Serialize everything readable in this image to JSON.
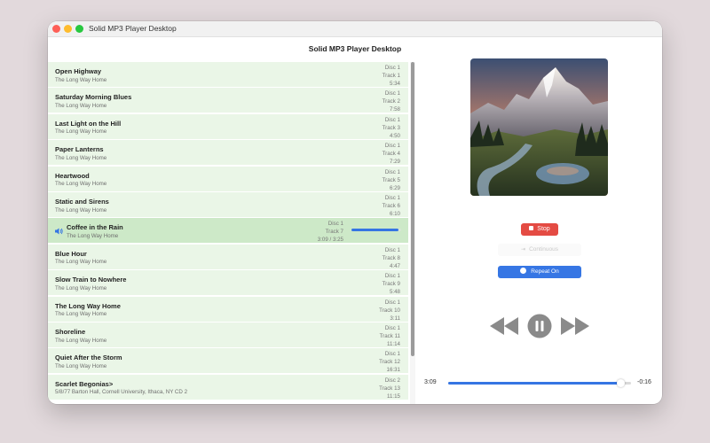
{
  "window": {
    "title": "Solid MP3 Player Desktop"
  },
  "header": {
    "title": "Solid MP3 Player Desktop"
  },
  "tracks": [
    {
      "title": "Open Highway",
      "artist": "The Long Way Home",
      "disc": "Disc 1",
      "track": "Track 1",
      "duration": "5:34"
    },
    {
      "title": "Saturday Morning Blues",
      "artist": "The Long Way Home",
      "disc": "Disc 1",
      "track": "Track 2",
      "duration": "7:58"
    },
    {
      "title": "Last Light on the Hill",
      "artist": "The Long Way Home",
      "disc": "Disc 1",
      "track": "Track 3",
      "duration": "4:50"
    },
    {
      "title": "Paper Lanterns",
      "artist": "The Long Way Home",
      "disc": "Disc 1",
      "track": "Track 4",
      "duration": "7:29"
    },
    {
      "title": "Heartwood",
      "artist": "The Long Way Home",
      "disc": "Disc 1",
      "track": "Track 5",
      "duration": "6:29"
    },
    {
      "title": "Static and Sirens",
      "artist": "The Long Way Home",
      "disc": "Disc 1",
      "track": "Track 6",
      "duration": "6:10"
    },
    {
      "title": "Coffee in the Rain",
      "artist": "The Long Way Home",
      "disc": "Disc 1",
      "track": "Track 7",
      "duration": "3:09 / 3:25",
      "playing": true,
      "progress": 0.94
    },
    {
      "title": "Blue Hour",
      "artist": "The Long Way Home",
      "disc": "Disc 1",
      "track": "Track 8",
      "duration": "4:47"
    },
    {
      "title": "Slow Train to Nowhere",
      "artist": "The Long Way Home",
      "disc": "Disc 1",
      "track": "Track 9",
      "duration": "5:48"
    },
    {
      "title": "The Long Way Home",
      "artist": "The Long Way Home",
      "disc": "Disc 1",
      "track": "Track 10",
      "duration": "3:11"
    },
    {
      "title": "Shoreline",
      "artist": "The Long Way Home",
      "disc": "Disc 1",
      "track": "Track 11",
      "duration": "11:14"
    },
    {
      "title": "Quiet After the Storm",
      "artist": "The Long Way Home",
      "disc": "Disc 1",
      "track": "Track 12",
      "duration": "16:31"
    },
    {
      "title": "Scarlet Begonias>",
      "artist": "5/8/77 Barton Hall, Cornell University, Ithaca, NY CD 2",
      "disc": "Disc 2",
      "track": "Track 13",
      "duration": "11:15"
    }
  ],
  "controls": {
    "stop_label": "Stop",
    "continuous_label": "Continuous",
    "repeat_label": "Repeat On"
  },
  "seek": {
    "elapsed": "3:09",
    "remaining": "-0:16",
    "progress": 0.94
  },
  "colors": {
    "accent": "#3575e3",
    "stop": "#e44b43",
    "row_bg": "#eaf6e7",
    "row_active": "#cde9c8"
  },
  "icons": {
    "speaker": "speaker-icon",
    "stop": "stop-icon",
    "continuous": "continuous-icon",
    "repeat": "repeat-icon",
    "previous": "previous-icon",
    "pause": "pause-icon",
    "next": "next-icon"
  }
}
